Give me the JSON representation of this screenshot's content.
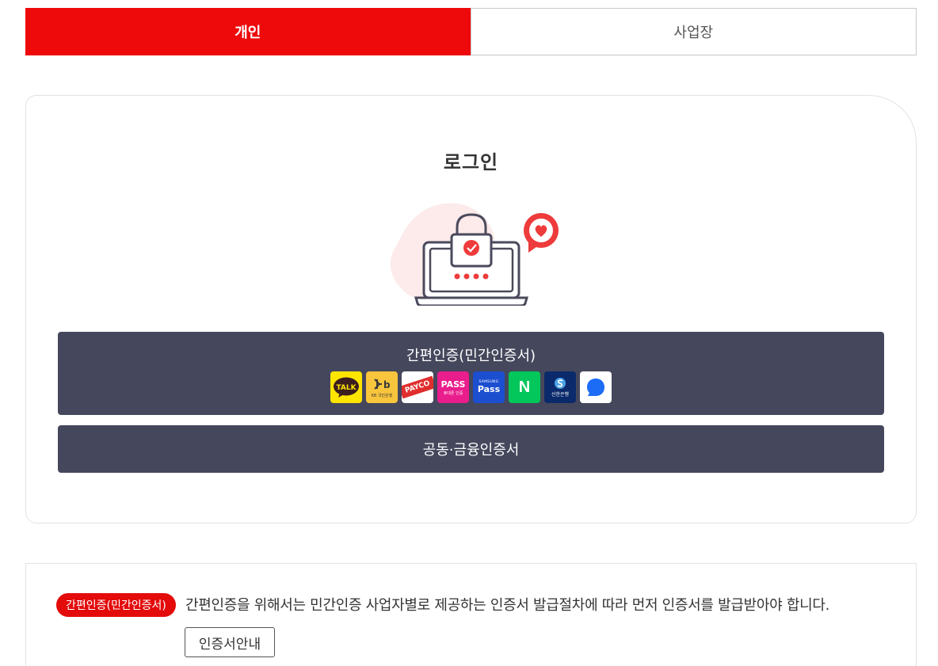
{
  "tabs": {
    "personal": "개인",
    "business": "사업장"
  },
  "login": {
    "title": "로그인"
  },
  "easy_auth": {
    "label": "간편인증(민간인증서)",
    "providers": [
      {
        "name": "kakao",
        "text": "TALK",
        "bg": "#fee500",
        "fg": "#3c1e1e"
      },
      {
        "name": "kb",
        "text": "KB 국민은행",
        "bg": "#f9c53c",
        "fg": "#3a3a3a"
      },
      {
        "name": "payco",
        "text": "PAYCO",
        "bg": "#ffffff",
        "fg": "#ffffff"
      },
      {
        "name": "pass",
        "text": "PASS",
        "sub": "휴대폰 인증",
        "bg": "#ea1d8c",
        "fg": "#ffffff"
      },
      {
        "name": "samsung-pass",
        "text": "Pass",
        "sub": "SAMSUNG",
        "bg": "#1c4fd0",
        "fg": "#ffffff"
      },
      {
        "name": "naver",
        "text": "N",
        "bg": "#03c75a",
        "fg": "#ffffff"
      },
      {
        "name": "shinhan",
        "text": "신한은행",
        "bg": "#0b2a6b",
        "fg": "#ffffff"
      },
      {
        "name": "toss",
        "text": "",
        "bg": "#ffffff",
        "fg": "#1c6cf5"
      }
    ]
  },
  "joint_auth": {
    "label": "공동·금융인증서"
  },
  "info": {
    "badge": "간편인증(민간인증서)",
    "text": "간편인증을 위해서는 민간인증 사업자별로 제공하는 인증서 발급절차에 따라 먼저 인증서를 발급받아야 합니다.",
    "guide_button": "인증서안내"
  },
  "colors": {
    "accent": "#ee0a0a",
    "button_dark": "#45475c"
  }
}
